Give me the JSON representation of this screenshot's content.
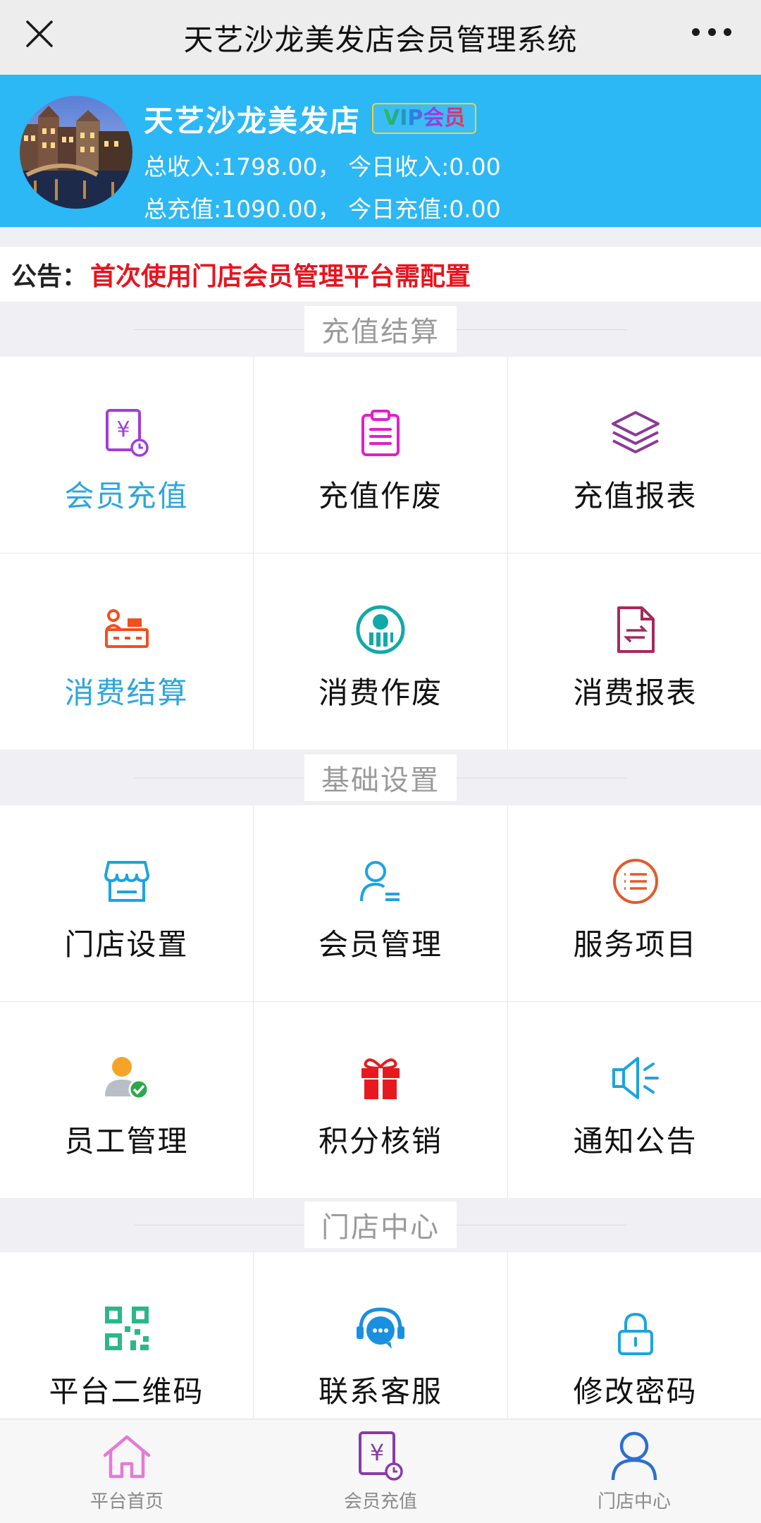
{
  "topbar": {
    "title": "天艺沙龙美发店会员管理系统"
  },
  "header": {
    "shop_name": "天艺沙龙美发店",
    "vip_badge": "VIP会员",
    "stat_line1": "总收入:1798.00， 今日收入:0.00",
    "stat_line2": "总充值:1090.00， 今日充值:0.00"
  },
  "notice": {
    "label": "公告：",
    "text": "首次使用门店会员管理平台需配置"
  },
  "sections": [
    {
      "title": "充值结算",
      "items": [
        {
          "label": "会员充值",
          "icon": "recharge-receipt-icon"
        },
        {
          "label": "充值作废",
          "icon": "clipboard-icon"
        },
        {
          "label": "充值报表",
          "icon": "layers-icon"
        },
        {
          "label": "消费结算",
          "icon": "cashier-icon"
        },
        {
          "label": "消费作废",
          "icon": "chart-circle-icon"
        },
        {
          "label": "消费报表",
          "icon": "document-exchange-icon"
        }
      ]
    },
    {
      "title": "基础设置",
      "items": [
        {
          "label": "门店设置",
          "icon": "storefront-icon"
        },
        {
          "label": "会员管理",
          "icon": "member-list-icon"
        },
        {
          "label": "服务项目",
          "icon": "service-list-icon"
        },
        {
          "label": "员工管理",
          "icon": "employee-check-icon"
        },
        {
          "label": "积分核销",
          "icon": "gift-icon"
        },
        {
          "label": "通知公告",
          "icon": "speaker-icon"
        }
      ]
    },
    {
      "title": "门店中心",
      "items": [
        {
          "label": "平台二维码",
          "icon": "qr-code-icon"
        },
        {
          "label": "联系客服",
          "icon": "customer-service-icon"
        },
        {
          "label": "修改密码",
          "icon": "lock-icon"
        }
      ]
    }
  ],
  "tabbar": {
    "items": [
      {
        "label": "平台首页",
        "icon": "home-icon"
      },
      {
        "label": "会员充值",
        "icon": "recharge-receipt-icon"
      },
      {
        "label": "门店中心",
        "icon": "user-icon"
      }
    ]
  },
  "colors": {
    "header_bg": "#2cb7f5",
    "notice_text": "#e8141e",
    "highlight_label": "#2ea5de",
    "tab_home": "#e47ad8",
    "tab_recharge": "#8a3aa8",
    "tab_center": "#2c6fd0"
  }
}
